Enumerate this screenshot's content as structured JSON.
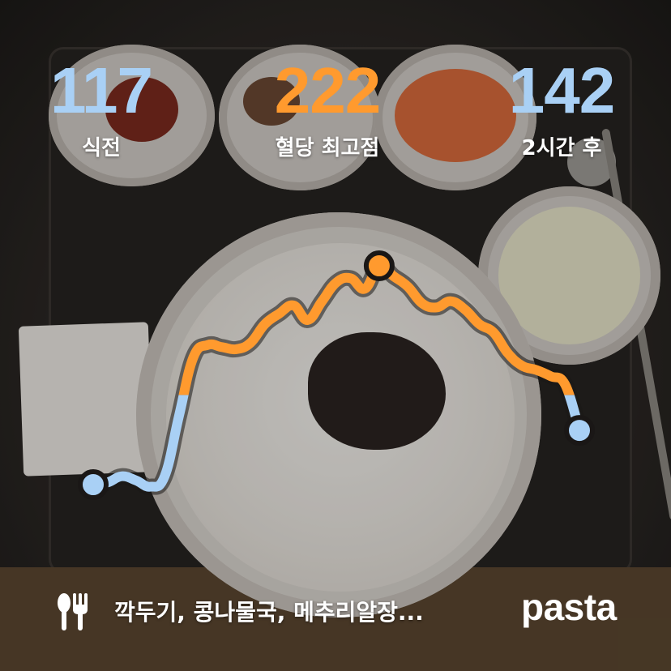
{
  "stats": {
    "before": {
      "value": "117",
      "label": "식전",
      "color": "#a9d0f5"
    },
    "peak": {
      "value": "222",
      "label": "혈당 최고점",
      "color": "#ff9a2e"
    },
    "after": {
      "value": "142",
      "label": "2시간 후",
      "color": "#a9d0f5"
    }
  },
  "chart_data": {
    "type": "line",
    "series": [
      {
        "values": [
          117,
          118,
          121,
          119,
          116,
          121,
          150,
          178,
          184,
          183,
          182,
          185,
          194,
          199,
          203,
          196,
          205,
          214,
          216,
          211,
          222,
          217,
          212,
          204,
          202,
          205,
          201,
          194,
          190,
          180,
          174,
          172,
          169,
          165,
          143
        ]
      }
    ],
    "threshold": 160,
    "colors": {
      "below": "#a9d0f5",
      "above": "#ff9a2e",
      "outline": "#1a1716"
    },
    "markers": [
      "start",
      "peak",
      "end"
    ]
  },
  "footer": {
    "meal_icon": "fork-knife-icon",
    "foods": "깍두기, 콩나물국, 메추리알장...",
    "brand": "pasta"
  }
}
